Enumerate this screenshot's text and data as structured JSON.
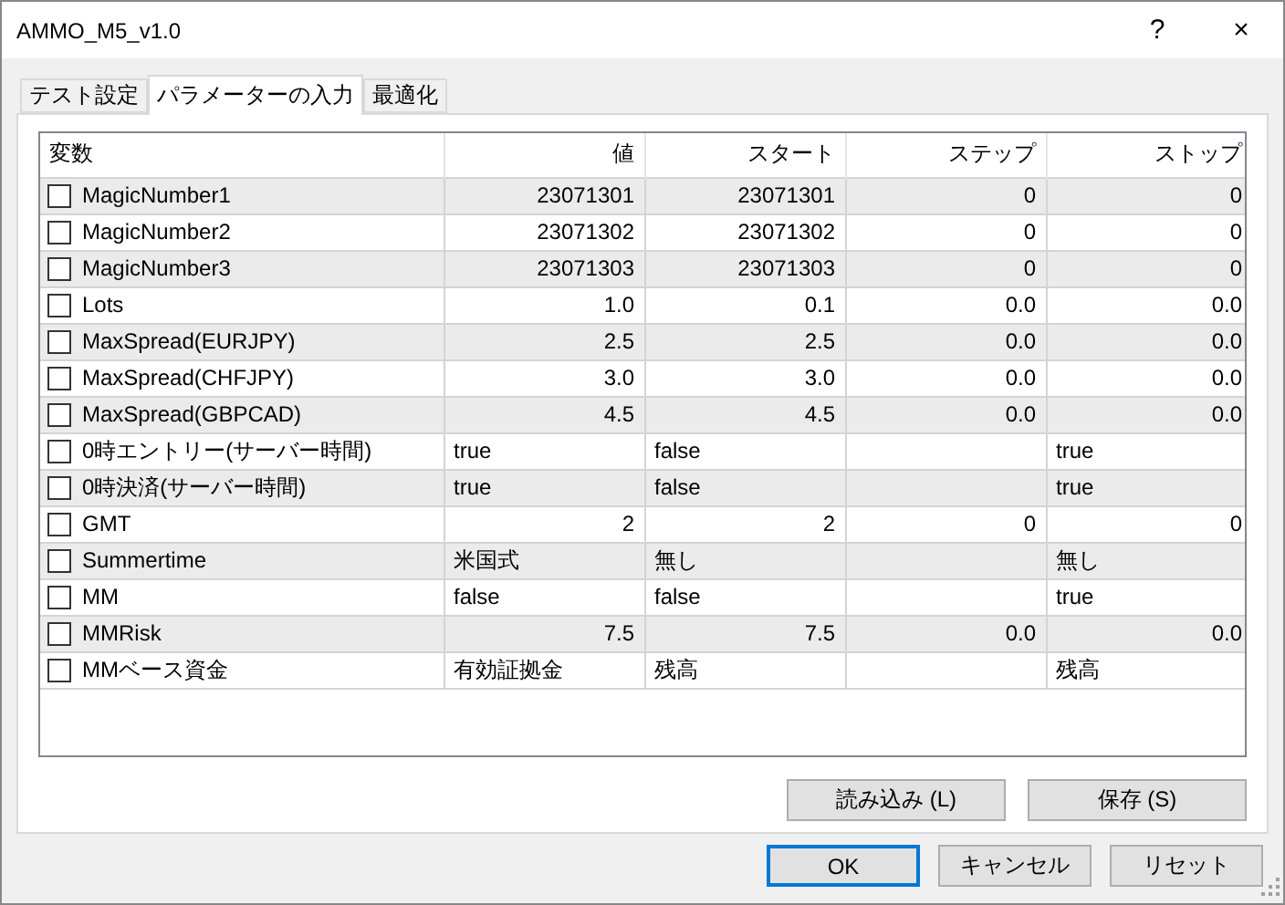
{
  "window": {
    "title": "AMMO_M5_v1.0",
    "title_buttons": [
      "?",
      "×"
    ]
  },
  "tabs": [
    {
      "label": "テスト設定",
      "selected": false
    },
    {
      "label": "パラメーターの入力",
      "selected": true
    },
    {
      "label": "最適化",
      "selected": false
    }
  ],
  "table": {
    "columns": [
      "変数",
      "値",
      "スタート",
      "ステップ",
      "ストップ"
    ],
    "rows": [
      {
        "kind": "number",
        "checked": false,
        "name": "MagicNumber1",
        "value": "23071301",
        "start": "23071301",
        "step": "0",
        "stop": "0"
      },
      {
        "kind": "number",
        "checked": false,
        "name": "MagicNumber2",
        "value": "23071302",
        "start": "23071302",
        "step": "0",
        "stop": "0"
      },
      {
        "kind": "number",
        "checked": false,
        "name": "MagicNumber3",
        "value": "23071303",
        "start": "23071303",
        "step": "0",
        "stop": "0"
      },
      {
        "kind": "number",
        "checked": false,
        "name": "Lots",
        "value": "1.0",
        "start": "0.1",
        "step": "0.0",
        "stop": "0.0"
      },
      {
        "kind": "number",
        "checked": false,
        "name": "MaxSpread(EURJPY)",
        "value": "2.5",
        "start": "2.5",
        "step": "0.0",
        "stop": "0.0"
      },
      {
        "kind": "number",
        "checked": false,
        "name": "MaxSpread(CHFJPY)",
        "value": "3.0",
        "start": "3.0",
        "step": "0.0",
        "stop": "0.0"
      },
      {
        "kind": "number",
        "checked": false,
        "name": "MaxSpread(GBPCAD)",
        "value": "4.5",
        "start": "4.5",
        "step": "0.0",
        "stop": "0.0"
      },
      {
        "kind": "text",
        "checked": false,
        "name": "0時エントリー(サーバー時間)",
        "value": "true",
        "start": "false",
        "stop": "true"
      },
      {
        "kind": "text",
        "checked": false,
        "name": "0時決済(サーバー時間)",
        "value": "true",
        "start": "false",
        "stop": "true"
      },
      {
        "kind": "number",
        "checked": false,
        "name": "GMT",
        "value": "2",
        "start": "2",
        "step": "0",
        "stop": "0"
      },
      {
        "kind": "text",
        "checked": false,
        "name": "Summertime",
        "value": "米国式",
        "start": "無し",
        "stop": "無し"
      },
      {
        "kind": "text",
        "checked": false,
        "name": "MM",
        "value": "false",
        "start": "false",
        "stop": "true"
      },
      {
        "kind": "number",
        "checked": false,
        "name": "MMRisk",
        "value": "7.5",
        "start": "7.5",
        "step": "0.0",
        "stop": "0.0"
      },
      {
        "kind": "text",
        "checked": false,
        "name": "MMベース資金",
        "value": "有効証拠金",
        "start": "残高",
        "stop": "残高"
      }
    ]
  },
  "panel_buttons": [
    "読み込み (L)",
    "保存 (S)"
  ],
  "dialog_buttons": [
    {
      "label": "OK",
      "default": true
    },
    {
      "label": "キャンセル",
      "default": false
    },
    {
      "label": "リセット",
      "default": false
    }
  ]
}
